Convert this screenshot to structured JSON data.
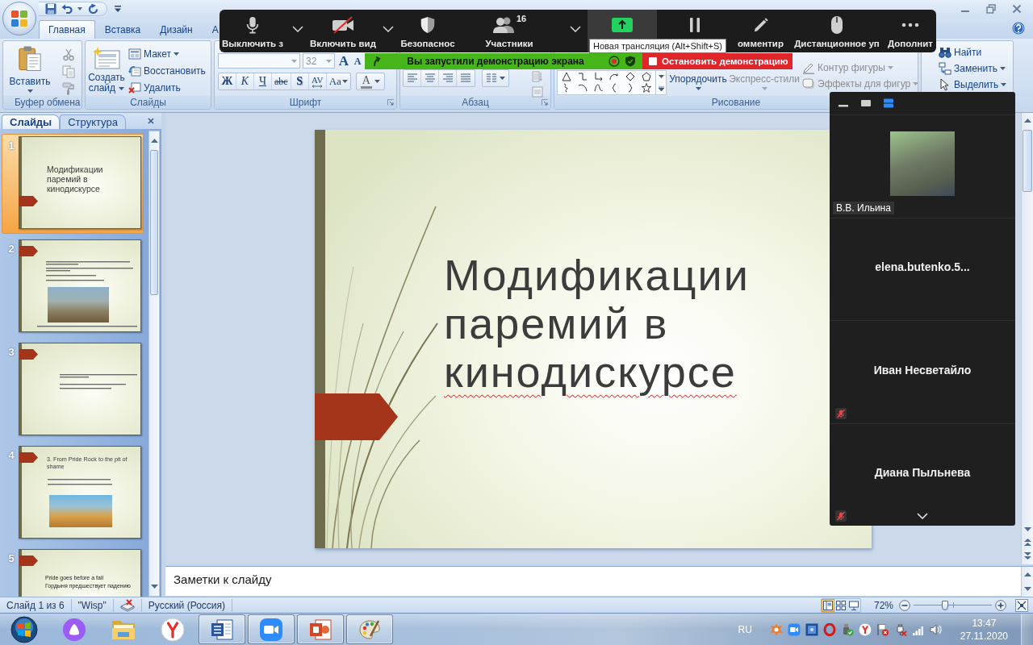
{
  "ribbon_tabs": [
    {
      "label": "Главная",
      "selected": true
    },
    {
      "label": "Вставка",
      "selected": false
    },
    {
      "label": "Дизайн",
      "selected": false
    },
    {
      "label": "А",
      "selected": false
    }
  ],
  "clipboard": {
    "label": "Буфер обмена",
    "paste": "Вставить",
    "tools": [
      {
        "kind": "cut",
        "disabled": true
      },
      {
        "kind": "copy",
        "disabled": true
      },
      {
        "kind": "format_painter",
        "disabled": true
      }
    ]
  },
  "slides_group": {
    "label": "Слайды",
    "new_slide": "Создать слайд",
    "commands": [
      {
        "label": "Макет",
        "kind": "layout",
        "caret": true
      },
      {
        "label": "Восстановить",
        "kind": "reset",
        "caret": false
      },
      {
        "label": "Удалить",
        "kind": "delete",
        "caret": false
      }
    ]
  },
  "font": {
    "label": "Шрифт",
    "size": {
      "value": "32",
      "disabled": true
    },
    "grow": "A",
    "shrink": "A",
    "styles": [
      {
        "text": "Ж",
        "kind": "bold"
      },
      {
        "text": "К",
        "kind": "italic"
      },
      {
        "text": "Ч",
        "kind": "underline"
      },
      {
        "text": "abc",
        "kind": "strike"
      },
      {
        "text": "S",
        "kind": "shadow"
      },
      {
        "text": "AV",
        "kind": "spacing"
      },
      {
        "text": "Aa",
        "kind": "case"
      }
    ],
    "color_button": "A"
  },
  "paragraph": {
    "label": "Абзац",
    "side_tools": [
      {
        "kind": "text_direction",
        "disabled": true
      },
      {
        "kind": "align_text",
        "disabled": true
      }
    ]
  },
  "drawing": {
    "label": "Рисование",
    "arrange": {
      "label": "Упорядочить",
      "disabled": false
    },
    "quick_styles": {
      "label": "Экспресс-стили",
      "disabled": true
    },
    "commands": [
      {
        "label": "Контур фигуры",
        "kind": "outline",
        "disabled": true
      },
      {
        "label": "Эффекты для фигур",
        "kind": "effects",
        "disabled": true
      }
    ]
  },
  "editing": {
    "commands": [
      {
        "label": "Найти",
        "kind": "find",
        "caret": false
      },
      {
        "label": "Заменить",
        "kind": "replace",
        "caret": true
      },
      {
        "label": "Выделить",
        "kind": "select",
        "caret": true
      }
    ]
  },
  "zoom_toolbar": {
    "buttons": [
      {
        "label": "Выключить з",
        "kind": "mic",
        "caret": true,
        "highlighted": false
      },
      {
        "label": "Включить вид",
        "kind": "video_off",
        "caret": true,
        "highlighted": false
      },
      {
        "label": "Безопаснос",
        "kind": "security",
        "caret": false,
        "highlighted": false
      },
      {
        "label": "Участники",
        "kind": "participants",
        "badge": "16",
        "caret": true,
        "highlighted": false
      },
      {
        "kind": "share",
        "caret": false,
        "highlighted": true
      },
      {
        "kind": "pause",
        "caret": false,
        "highlighted": false
      },
      {
        "label": "омментир",
        "kind": "annotate",
        "caret": false,
        "highlighted": false
      },
      {
        "label": "Дистанционное уп",
        "kind": "remote",
        "caret": false,
        "highlighted": false
      },
      {
        "label": "Дополнит",
        "kind": "more",
        "caret": false,
        "highlighted": false
      }
    ],
    "tooltip": "Новая трансляция (Alt+Shift+S)"
  },
  "share_bar": {
    "message": "Вы запустили демонстрацию экрана",
    "stop": "Остановить демонстрацию"
  },
  "participants_panel": {
    "views": [
      {
        "kind": "hide",
        "selected": false
      },
      {
        "kind": "speaker",
        "selected": false
      },
      {
        "kind": "strip",
        "selected": true
      }
    ],
    "participants": [
      {
        "name": "В.В. Ильина",
        "kind": "video",
        "muted": false
      },
      {
        "name": "elena.butenko.5...",
        "kind": "name",
        "muted": false
      },
      {
        "name": "Иван Несветайло",
        "kind": "name",
        "muted": true
      },
      {
        "name": "Диана Пыльнева",
        "kind": "name",
        "muted": true
      }
    ]
  },
  "slides_pane": {
    "tabs": [
      {
        "label": "Слайды",
        "selected": true
      },
      {
        "label": "Структура",
        "selected": false
      }
    ],
    "thumbnails": [
      {
        "number": "1",
        "kind": "title",
        "selected": true,
        "title": "Модификации паремий в кинодискурсе"
      },
      {
        "number": "2",
        "kind": "text_picture",
        "selected": false
      },
      {
        "number": "3",
        "kind": "text",
        "selected": false
      },
      {
        "number": "4",
        "kind": "title_picture",
        "selected": false,
        "title": "3. From Pride Rock to the pit of shame"
      },
      {
        "number": "5",
        "kind": "lines",
        "selected": false,
        "lines": [
          "Pride goes before a fall",
          "Гордыня предшествует падению"
        ]
      }
    ]
  },
  "slide": {
    "title": [
      {
        "text": "Модификации паремий в ",
        "misspelled": false
      },
      {
        "text": "кинодискурсе",
        "misspelled": true
      }
    ]
  },
  "notes": {
    "placeholder": "Заметки к слайду"
  },
  "status_bar": {
    "position": "Слайд 1 из 6",
    "theme": "\"Wisp\"",
    "language": "Русский (Россия)",
    "views": [
      {
        "kind": "normal",
        "selected": true
      },
      {
        "kind": "sorter",
        "selected": false
      },
      {
        "kind": "show",
        "selected": false
      }
    ],
    "zoom": "72%",
    "zoom_slider": {
      "level": 0.4
    }
  },
  "taskbar": {
    "apps": [
      {
        "kind": "alice",
        "running": false
      },
      {
        "kind": "folder",
        "running": false
      },
      {
        "kind": "yandex",
        "running": false
      },
      {
        "kind": "word",
        "running": true
      },
      {
        "kind": "zoom",
        "running": true
      },
      {
        "kind": "powerpoint",
        "running": true
      },
      {
        "kind": "paint",
        "running": true
      }
    ],
    "language": "RU",
    "time": "13:47",
    "date": "27.11.2020"
  }
}
